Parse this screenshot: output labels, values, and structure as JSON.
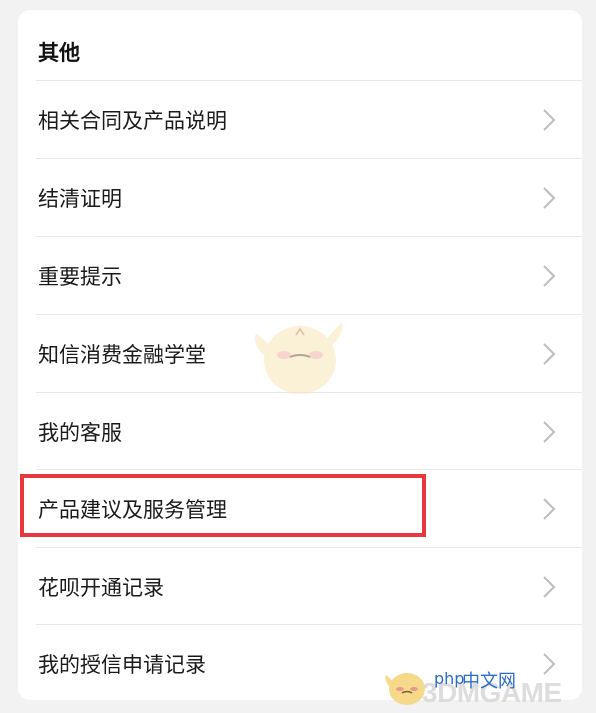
{
  "section": {
    "title": "其他"
  },
  "menu": {
    "items": [
      {
        "label": "相关合同及产品说明"
      },
      {
        "label": "结清证明"
      },
      {
        "label": "重要提示"
      },
      {
        "label": "知信消费金融学堂"
      },
      {
        "label": "我的客服"
      },
      {
        "label": "产品建议及服务管理"
      },
      {
        "label": "花呗开通记录"
      },
      {
        "label": "我的授信申请记录"
      }
    ],
    "highlighted_item": "产品建议及服务管理"
  },
  "watermark": {
    "php_text": "php",
    "zhongwen_text": "中文网",
    "brand_text": "3DMGAME"
  },
  "colors": {
    "highlight_border": "#e8383d",
    "chevron": "#bdbdbd",
    "background": "#f2f2f2",
    "card": "#ffffff"
  }
}
